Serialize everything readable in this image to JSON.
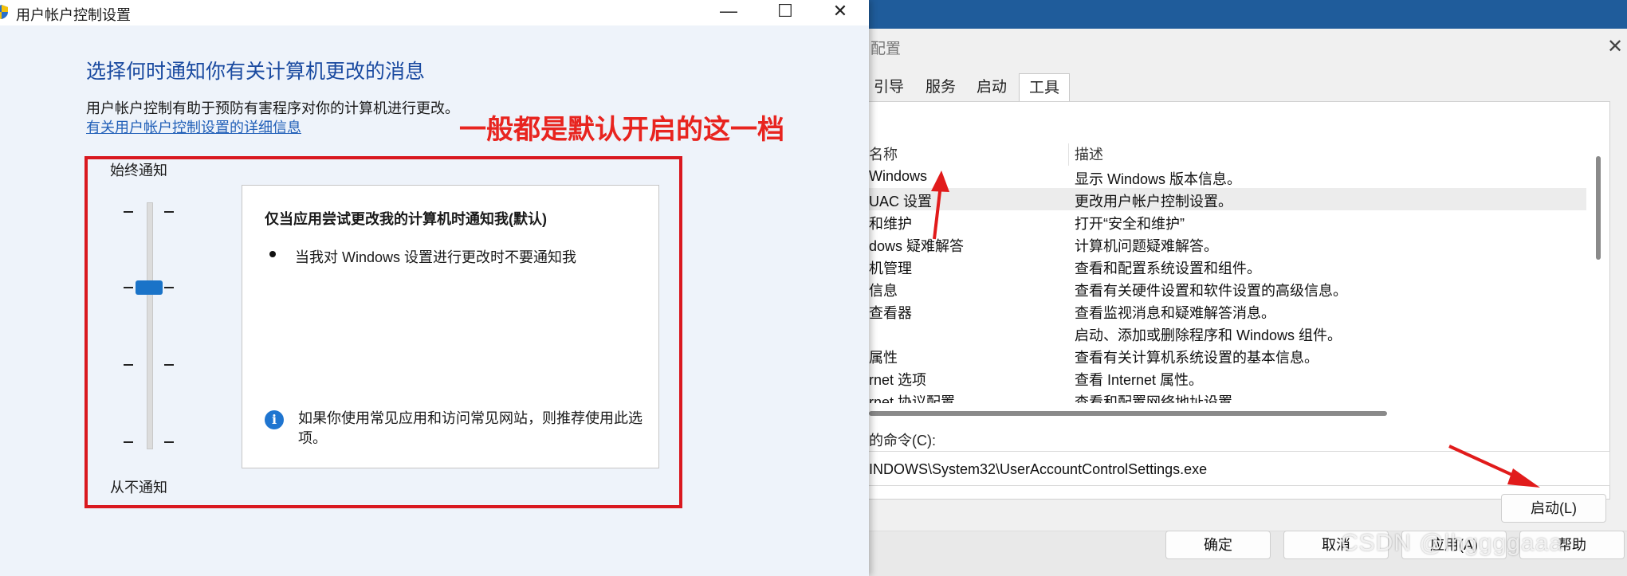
{
  "uac_window": {
    "title": "用户帐户控制设置",
    "controls": {
      "minimize": "—",
      "maximize": "☐",
      "close": "✕"
    },
    "heading": "选择何时通知你有关计算机更改的消息",
    "description": "用户帐户控制有助于预防有害程序对你的计算机进行更改。",
    "link": "有关用户帐户控制设置的详细信息",
    "slider": {
      "top_label": "始终通知",
      "bottom_label": "从不通知",
      "level_count": 4,
      "selected_level": 2
    },
    "info": {
      "title": "仅当应用尝试更改我的计算机时通知我(默认)",
      "item": "当我对 Windows 设置进行更改时不要通知我",
      "tip": "如果你使用常见应用和访问常见网站，则推荐使用此选项。",
      "tip_icon": "info-icon"
    }
  },
  "annotation": {
    "text": "一般都是默认开启的这一档",
    "color": "#e8241f"
  },
  "msconfig": {
    "title": "配置",
    "close": "✕",
    "tabs": [
      "引导",
      "服务",
      "启动",
      "工具"
    ],
    "active_tab": "工具",
    "columns": [
      "名称",
      "描述"
    ],
    "rows": [
      {
        "name": "Windows",
        "desc": "显示 Windows 版本信息。"
      },
      {
        "name": "UAC 设置",
        "desc": "更改用户帐户控制设置。",
        "selected": true
      },
      {
        "name": "和维护",
        "desc": "打开“安全和维护”"
      },
      {
        "name": "dows 疑难解答",
        "desc": "计算机问题疑难解答。"
      },
      {
        "name": "机管理",
        "desc": "查看和配置系统设置和组件。"
      },
      {
        "name": "信息",
        "desc": "查看有关硬件设置和软件设置的高级信息。"
      },
      {
        "name": "查看器",
        "desc": "查看监视消息和疑难解答消息。"
      },
      {
        "name": "",
        "desc": "启动、添加或删除程序和 Windows 组件。"
      },
      {
        "name": "属性",
        "desc": "查看有关计算机系统设置的基本信息。"
      },
      {
        "name": "rnet 选项",
        "desc": "查看 Internet 属性。"
      },
      {
        "name": "rnet 协议配置",
        "desc": "查看和配置网络地址设置。"
      }
    ],
    "command_label": "的命令(C):",
    "command_value": "INDOWS\\System32\\UserAccountControlSettings.exe",
    "launch_button": "启动(L)",
    "ok_button": "确定",
    "cancel_button": "取消",
    "apply_button": "应用(A)",
    "help_button": "帮助"
  },
  "watermark": "CSDN @lhggggaaa"
}
